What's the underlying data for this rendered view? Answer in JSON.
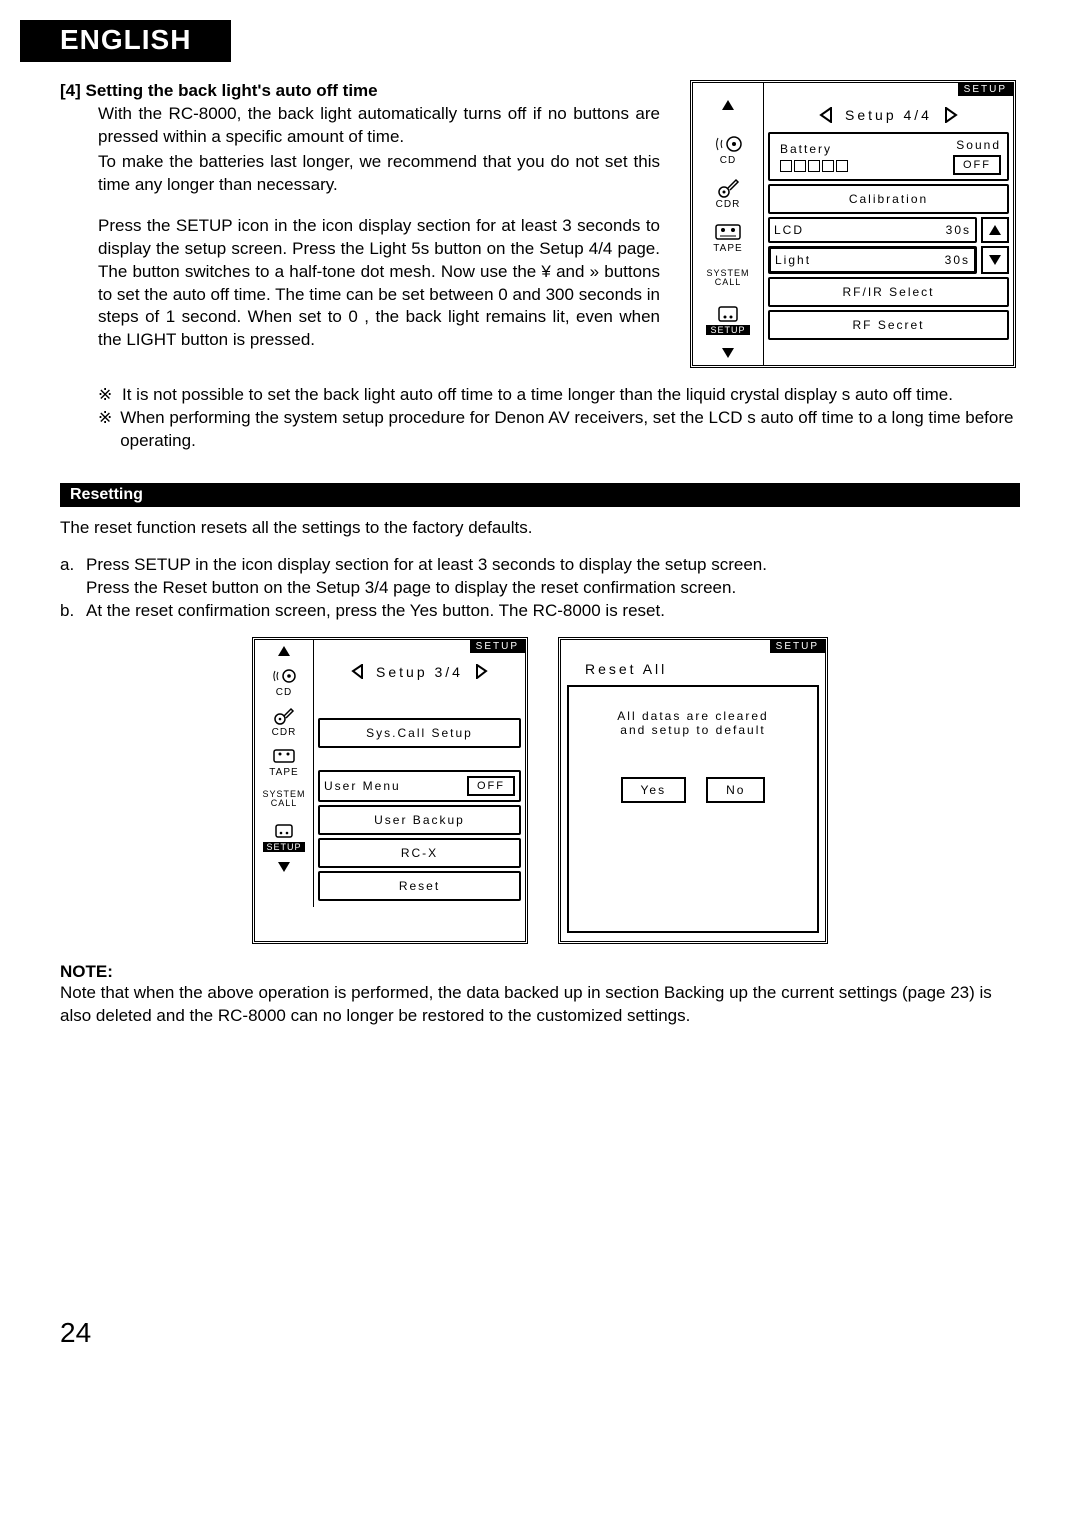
{
  "header": {
    "language": "ENGLISH"
  },
  "section4": {
    "num": "[4]",
    "title": "Setting the back light's auto off time",
    "p1": "With the RC-8000, the back light automatically turns off if no buttons are pressed within a specific amount of time.",
    "p2": "To make the batteries last longer, we recommend that you do not set this time any longer than necessary.",
    "p3": "Press the  SETUP  icon in the icon display section for at least 3 seconds to display the setup screen.  Press the  Light 5s  button on the  Setup 4/4  page.  The button switches to a half-tone dot mesh.  Now use the  ¥  and  »  buttons to set the auto off time.   The time can be set between 0 and 300 seconds in steps of 1 second.  When set to  0 , the back light remains lit, even when the LIGHT button is pressed.",
    "note1": "It is not possible to set the back light auto off time to a time longer than the liquid crystal display s auto off time.",
    "note2": "When performing the system setup procedure for Denon AV receivers, set the LCD s auto off time to a long time before operating.",
    "marker": "※"
  },
  "screen44": {
    "tag": "SETUP",
    "title": "Setup 4/4",
    "icons": [
      "CD",
      "CDR",
      "TAPE",
      "SYSTEM CALL",
      "SETUP"
    ],
    "battery_label": "Battery",
    "sound_label": "Sound",
    "sound_value": "OFF",
    "calibration": "Calibration",
    "lcd_label": "LCD",
    "lcd_value": "30s",
    "light_label": "Light",
    "light_value": "30s",
    "rfir": "RF/IR Select",
    "rfsecret": "RF Secret"
  },
  "resetting": {
    "heading": "Resetting",
    "intro": "The reset function resets all the settings to the factory defaults.",
    "a_marker": "a.",
    "a_line1": "Press  SETUP  in the icon display section for at least 3 seconds to display the setup screen.",
    "a_line2": "Press the  Reset  button on the  Setup 3/4  page to display the reset confirmation screen.",
    "b_marker": "b.",
    "b_line": "At the reset confirmation screen, press the  Yes  button.  The RC-8000 is reset."
  },
  "screen34": {
    "tag": "SETUP",
    "title": "Setup 3/4",
    "icons": [
      "CD",
      "CDR",
      "TAPE",
      "SYSTEM CALL",
      "SETUP"
    ],
    "syscall": "Sys.Call Setup",
    "usermenu": "User Menu",
    "usermenu_val": "OFF",
    "userbackup": "User Backup",
    "rcx": "RC-X",
    "reset": "Reset"
  },
  "reset_dialog": {
    "tag": "SETUP",
    "title": "Reset All",
    "msg1": "All datas are cleared",
    "msg2": "and setup to default",
    "yes": "Yes",
    "no": "No"
  },
  "note": {
    "label": "NOTE:",
    "text": "Note that when the above operation is performed, the data backed up in section  Backing up the current settings  (page 23) is also deleted and the RC-8000 can no longer be restored to the customized settings."
  },
  "page_number": "24"
}
